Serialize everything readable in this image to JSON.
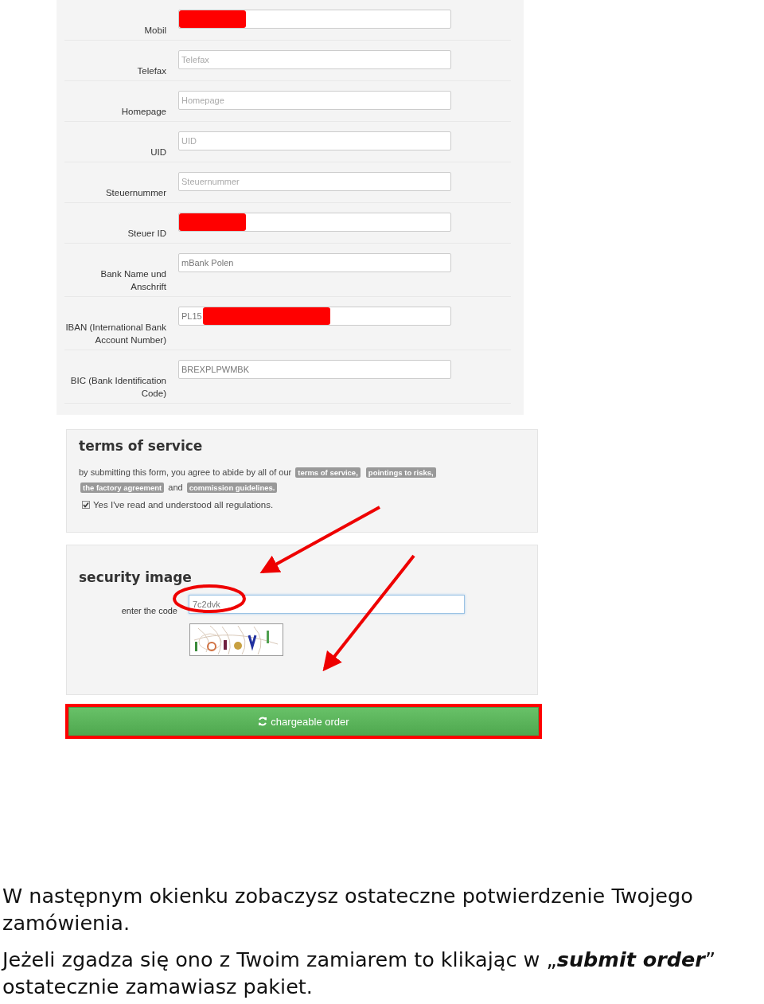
{
  "contact_form": {
    "rows": [
      {
        "label": "Mobil",
        "placeholder": "",
        "value": "",
        "redacted": true
      },
      {
        "label": "Telefax",
        "placeholder": "Telefax",
        "value": "",
        "redacted": false
      },
      {
        "label": "Homepage",
        "placeholder": "Homepage",
        "value": "",
        "redacted": false
      },
      {
        "label": "UID",
        "placeholder": "UID",
        "value": "",
        "redacted": false
      },
      {
        "label": "Steuernummer",
        "placeholder": "Steuernummer",
        "value": "",
        "redacted": false
      },
      {
        "label": "Steuer ID",
        "placeholder": "",
        "value": "",
        "redacted": true
      },
      {
        "label": "Bank Name und Anschrift",
        "placeholder": "",
        "value": "mBank Polen",
        "redacted": false
      },
      {
        "label": "IBAN (International Bank Account Number)",
        "placeholder": "",
        "value": "PL15",
        "redacted": true
      },
      {
        "label": "BIC (Bank Identification Code)",
        "placeholder": "",
        "value": "BREXPLPWMBK",
        "redacted": false
      }
    ]
  },
  "terms": {
    "title": "terms of service",
    "sentence": [
      {
        "kind": "text",
        "text": "by submitting this form, you agree to abide by all of our"
      },
      {
        "kind": "link",
        "text": "terms of service,"
      },
      {
        "kind": "link",
        "text": "pointings to risks,"
      },
      {
        "kind": "link",
        "text": "the factory agreement"
      },
      {
        "kind": "text",
        "text": "and"
      },
      {
        "kind": "link",
        "text": "commission guidelines."
      }
    ],
    "checkbox": {
      "label": "Yes I've read and understood all regulations.",
      "checked": true
    }
  },
  "security": {
    "title": "security image",
    "label": "enter the code",
    "value": "7c2dvk"
  },
  "submit_button": {
    "label": "chargeable order",
    "highlighted": true
  },
  "caption": [
    "W następnym okienku zobaczysz ostateczne potwierdzenie Twojego zamówienia.",
    "Jeżeli zgadza się ono z Twoim zamiarem to klikając w „**submit order**” ostatecznie zamawiasz pakiet."
  ]
}
